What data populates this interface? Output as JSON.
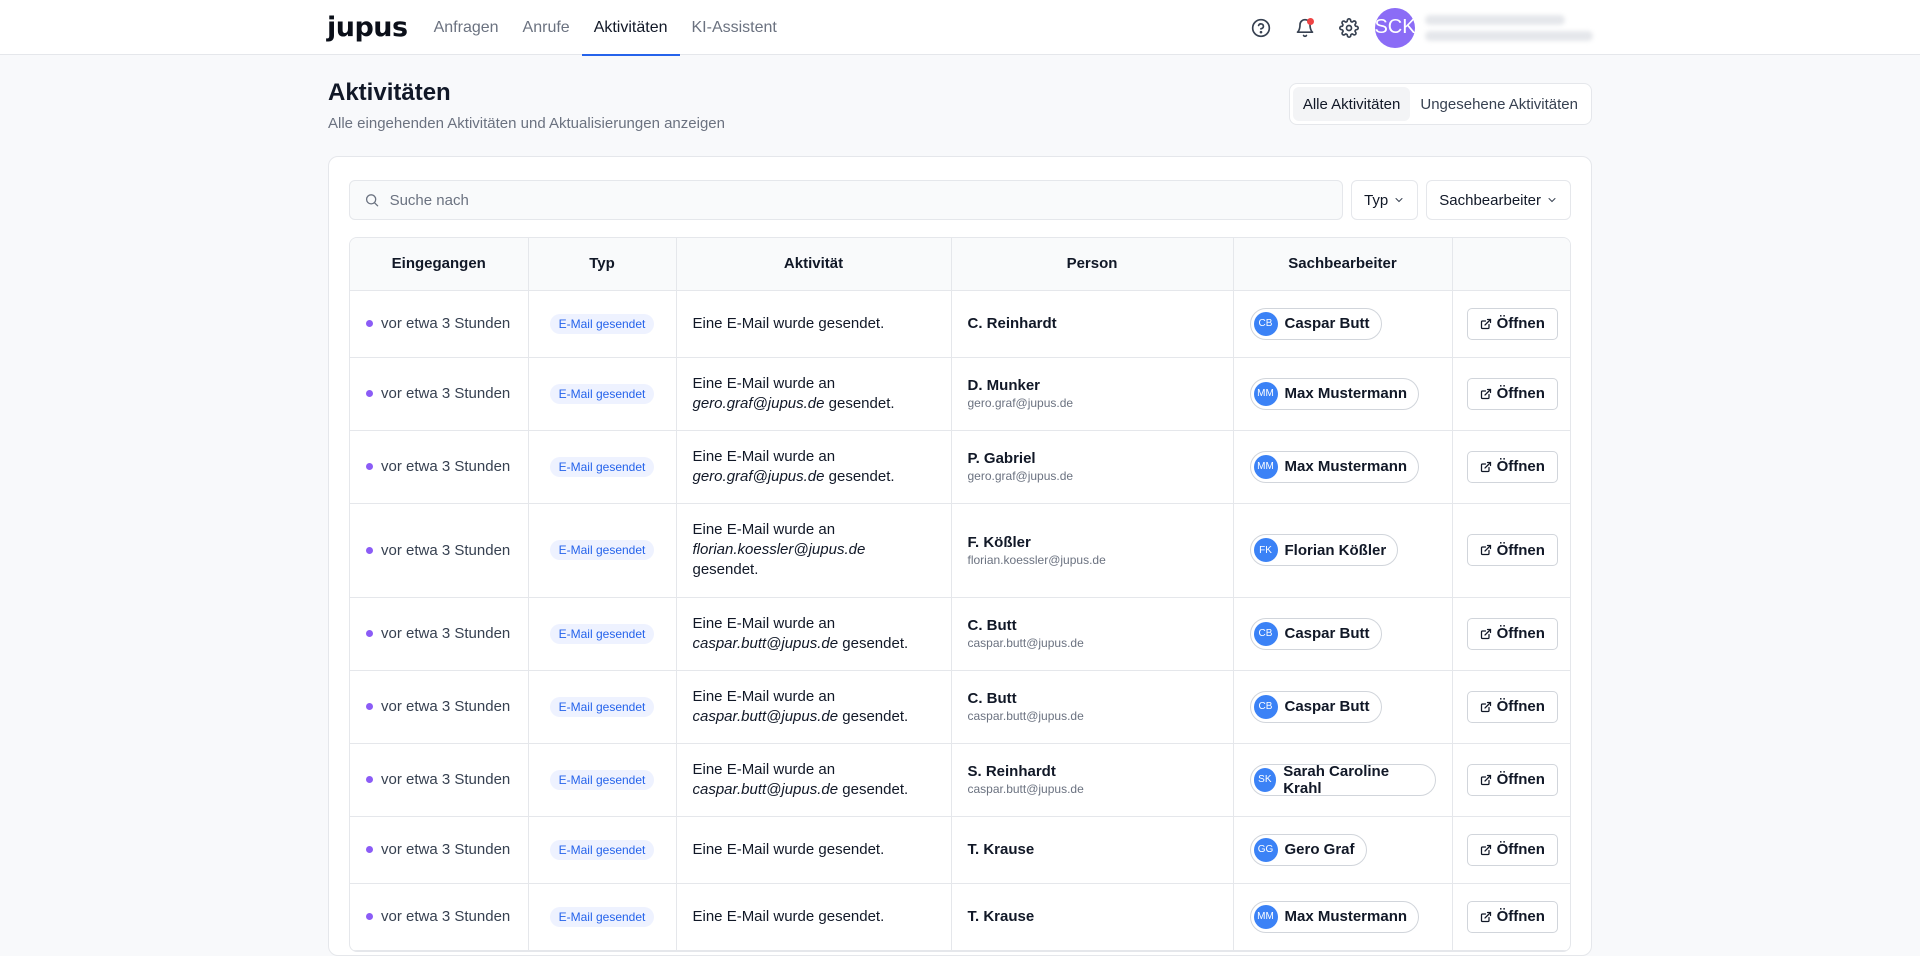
{
  "app": {
    "logo": "jupus"
  },
  "nav": {
    "items": [
      "Anfragen",
      "Anrufe",
      "Aktivitäten",
      "KI-Assistent"
    ],
    "active": 2
  },
  "topbar": {
    "help_icon": "help-circle-icon",
    "bell_icon": "bell-icon",
    "settings_icon": "gear-icon",
    "avatar_initials": "SCK"
  },
  "page": {
    "title": "Aktivitäten",
    "subtitle": "Alle eingehenden Aktivitäten und Aktualisierungen anzeigen",
    "segments": [
      "Alle Aktivitäten",
      "Ungesehene Aktivitäten"
    ],
    "active_segment": 0
  },
  "toolbar": {
    "search_placeholder": "Suche nach",
    "filter_type": "Typ",
    "filter_assignee": "Sachbearbeiter"
  },
  "table": {
    "headers": [
      "Eingegangen",
      "Typ",
      "Aktivität",
      "Person",
      "Sachbearbeiter",
      ""
    ],
    "open_label": "Öffnen",
    "rows": [
      {
        "received": "vor etwa 3 Stunden",
        "type": "E-Mail gesendet",
        "activity_pre": "Eine E-Mail wurde gesendet.",
        "activity_email": "",
        "activity_post": "",
        "person": "C. Reinhardt",
        "person_email": "",
        "assignee": "Caspar Butt",
        "initials": "CB"
      },
      {
        "received": "vor etwa 3 Stunden",
        "type": "E-Mail gesendet",
        "activity_pre": "Eine E-Mail wurde an",
        "activity_email": "gero.graf@jupus.de",
        "activity_post": " gesendet.",
        "person": "D. Munker",
        "person_email": "gero.graf@jupus.de",
        "assignee": "Max Mustermann",
        "initials": "MM"
      },
      {
        "received": "vor etwa 3 Stunden",
        "type": "E-Mail gesendet",
        "activity_pre": "Eine E-Mail wurde an",
        "activity_email": "gero.graf@jupus.de",
        "activity_post": " gesendet.",
        "person": "P. Gabriel",
        "person_email": "gero.graf@jupus.de",
        "assignee": "Max Mustermann",
        "initials": "MM"
      },
      {
        "received": "vor etwa 3 Stunden",
        "type": "E-Mail gesendet",
        "activity_pre": "Eine E-Mail wurde an",
        "activity_email": "florian.koessler@jupus.de",
        "activity_post": " gesendet.",
        "person": "F. Kößler",
        "person_email": "florian.koessler@jupus.de",
        "assignee": "Florian Kößler",
        "initials": "FK"
      },
      {
        "received": "vor etwa 3 Stunden",
        "type": "E-Mail gesendet",
        "activity_pre": "Eine E-Mail wurde an",
        "activity_email": "caspar.butt@jupus.de",
        "activity_post": " gesendet.",
        "person": "C. Butt",
        "person_email": "caspar.butt@jupus.de",
        "assignee": "Caspar Butt",
        "initials": "CB"
      },
      {
        "received": "vor etwa 3 Stunden",
        "type": "E-Mail gesendet",
        "activity_pre": "Eine E-Mail wurde an",
        "activity_email": "caspar.butt@jupus.de",
        "activity_post": " gesendet.",
        "person": "C. Butt",
        "person_email": "caspar.butt@jupus.de",
        "assignee": "Caspar Butt",
        "initials": "CB"
      },
      {
        "received": "vor etwa 3 Stunden",
        "type": "E-Mail gesendet",
        "activity_pre": "Eine E-Mail wurde an",
        "activity_email": "caspar.butt@jupus.de",
        "activity_post": " gesendet.",
        "person": "S. Reinhardt",
        "person_email": "caspar.butt@jupus.de",
        "assignee": "Sarah Caroline Krahl",
        "initials": "SK"
      },
      {
        "received": "vor etwa 3 Stunden",
        "type": "E-Mail gesendet",
        "activity_pre": "Eine E-Mail wurde gesendet.",
        "activity_email": "",
        "activity_post": "",
        "person": "T. Krause",
        "person_email": "",
        "assignee": "Gero Graf",
        "initials": "GG"
      },
      {
        "received": "vor etwa 3 Stunden",
        "type": "E-Mail gesendet",
        "activity_pre": "Eine E-Mail wurde gesendet.",
        "activity_email": "",
        "activity_post": "",
        "person": "T. Krause",
        "person_email": "",
        "assignee": "Max Mustermann",
        "initials": "MM"
      }
    ]
  },
  "colors": {
    "accent": "#2563eb",
    "unread_dot": "#8b5cf6",
    "avatar": "#8b6cf6",
    "notification": "#ef4444",
    "initials_bg": "#3b82f6"
  }
}
